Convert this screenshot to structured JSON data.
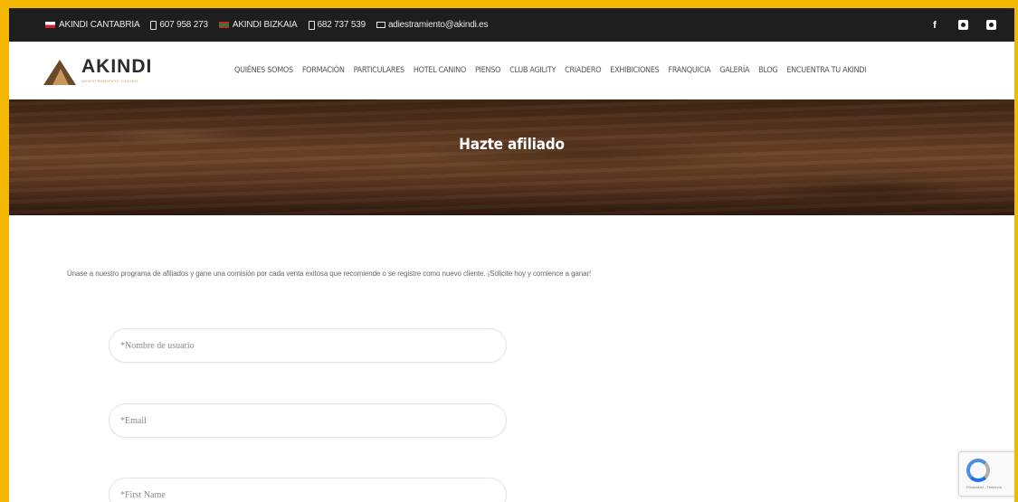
{
  "topbar": {
    "cantabria_label": "AKINDI CANTABRIA",
    "cantabria_phone": "607 958 273",
    "bizkaia_label": "AKINDI BIZKAIA",
    "bizkaia_phone": "682 737 539",
    "email": "adiestramiento@akindi.es",
    "social_icons": [
      "facebook-icon",
      "instagram-icon",
      "youtube-icon"
    ],
    "facebook_glyph": "f"
  },
  "brand": {
    "name": "AKINDI",
    "tagline": "ADIESTRAMIENTO CANINO"
  },
  "nav": {
    "items": [
      "QUIÉNES SOMOS",
      "FORMACIÓN",
      "PARTICULARES",
      "HOTEL CANINO",
      "PIENSO",
      "CLUB AGILITY",
      "CRIADERO",
      "EXHIBICIONES",
      "FRANQUICIA",
      "GALERÍA",
      "BLOG",
      "ENCUENTRA TU AKINDI"
    ]
  },
  "hero": {
    "title": "Hazte afiliado"
  },
  "main": {
    "intro": "Únase a nuestro programa de afiliados y gane una comisión por cada venta exitosa que recomiende o se registre como nuevo cliente. ¡Solicite hoy y comience a ganar!",
    "fields": {
      "username_placeholder": "*Nombre de usuario",
      "email_placeholder": "*Email",
      "firstname_placeholder": "*First Name"
    }
  },
  "recaptcha": {
    "text": "Privacidad - Términos"
  },
  "colors": {
    "frame": "#f5b800",
    "topbar": "#1e1e1e",
    "hero_wood": "#5a3720"
  }
}
